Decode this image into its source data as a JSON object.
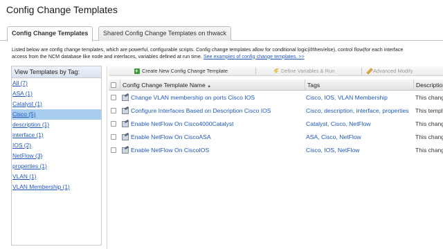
{
  "page": {
    "title": "Config Change Templates"
  },
  "tabs": [
    {
      "label": "Config Change Templates",
      "active": true
    },
    {
      "label": "Shared Config Change Templates on thwack",
      "active": false
    }
  ],
  "intro": {
    "line1": "Listed below are config change templates, which are powerful, configurable scripts. Config change templates allow for conditional logic(if/then/else), control flow(for each interface",
    "line2": "access from the NCM database like node and interfaces, variables defined at run time.",
    "link": "See examples of config change templates. >>"
  },
  "sidebar": {
    "header": "View Templates by Tag:",
    "items": [
      {
        "label": "All (7)"
      },
      {
        "label": "ASA (1)"
      },
      {
        "label": "Catalyst (1)"
      },
      {
        "label": "Cisco (5)",
        "selected": true
      },
      {
        "label": "description (1)"
      },
      {
        "label": "interface (1)"
      },
      {
        "label": "IOS (2)"
      },
      {
        "label": "NetFlow (3)"
      },
      {
        "label": "properties (1)"
      },
      {
        "label": "VLAN (1)"
      },
      {
        "label": "VLAN Membership (1)"
      }
    ]
  },
  "toolbar": {
    "create": "Create New Config Change Template",
    "define": "Define Variables & Run",
    "advanced": "Advanced Modify"
  },
  "grid": {
    "columns": {
      "name": "Config Change Template Name",
      "sort_indicator": "▲",
      "tags": "Tags",
      "description": "Description"
    },
    "rows": [
      {
        "name": "Change VLAN membership on ports Cisco IOS",
        "tags": "Cisco, IOS, VLAN Membership",
        "description": "This change"
      },
      {
        "name": "Configure Interfaces Based on Description Cisco IOS",
        "tags": "Cisco, description, interface, properties",
        "description": "This template"
      },
      {
        "name": "Enable NetFlow On Cisco4000Catalyst",
        "tags": "Catalyst, Cisco, NetFlow",
        "description": "This change"
      },
      {
        "name": "Enable NetFlow On CiscoASA",
        "tags": "ASA, Cisco, NetFlow",
        "description": "This change"
      },
      {
        "name": "Enable NetFlow On CiscoIOS",
        "tags": "Cisco, IOS, NetFlow",
        "description": "This change"
      }
    ]
  },
  "icons": {
    "create": "add-icon",
    "define": "lightning-icon",
    "advanced": "pencil-icon",
    "template": "template-icon"
  }
}
